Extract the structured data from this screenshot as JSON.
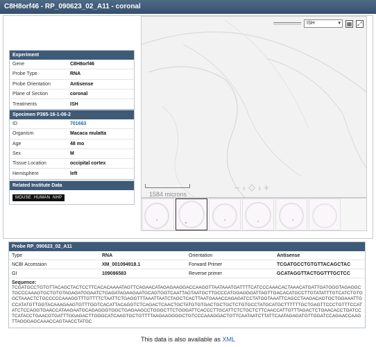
{
  "title": "C8H8orf46 - RP_090623_02_A11 - coronal",
  "experiment": {
    "header": "Experiment",
    "rows": [
      {
        "key": "Gene",
        "value": "C8H8orf46"
      },
      {
        "key": "Probe Type",
        "value": "RNA"
      },
      {
        "key": "Probe Orientation",
        "value": "Antisense"
      },
      {
        "key": "Plane of Section",
        "value": "coronal"
      },
      {
        "key": "Treatments",
        "value": "ISH"
      }
    ]
  },
  "specimen": {
    "header": "Specimen P365-16-1-06-2",
    "rows": [
      {
        "key": "ID",
        "value": "701663"
      },
      {
        "key": "Organism",
        "value": "Macaca mulatta"
      },
      {
        "key": "Age",
        "value": "48 mo"
      },
      {
        "key": "Sex",
        "value": "M"
      },
      {
        "key": "Tissue Location",
        "value": "occipital cortex"
      },
      {
        "key": "Hemisphere",
        "value": "left"
      }
    ]
  },
  "related": {
    "header": "Related Institute Data",
    "items": [
      "MOUSE",
      "HUMAN",
      "NHP"
    ]
  },
  "viewer": {
    "stain_select": "ISH",
    "scale_label": "1584 microns",
    "selected_thumbnail": 2,
    "thumbnail_count": 6
  },
  "probe": {
    "header": "Probe RP_090623_02_A11",
    "rows": [
      {
        "k1": "Type",
        "v1": "RNA",
        "k2": "Orientation",
        "v2": "Antisense"
      },
      {
        "k1": "NCBI Accession",
        "v1": "XM_001094918.1",
        "k2": "Forward Primer",
        "v2": "TCGATGCCTGTGTTACAGCTAC"
      },
      {
        "k1": "GI",
        "v1": "109086583",
        "k2": "Reverse primer",
        "v2": "GCATAGGTTACTGGTTTGCTCC"
      }
    ],
    "sequence_label": "Sequence:",
    "sequence": "TCGATGCCTGTGTTACAGCTACTCCTTCACACAAAATAGTTCAGAACATAGAGAAGGACCAAGGTTAATAAATGATTTTCATCCCAAACACTAAACATGATTGATGGGTAGAGGCTGCCCAAAGTGCTGTGTAGAGATGGAATCTGAGATAGAAGAATGCAGTGGTCAATTAGTAATGCTTGCCCATGGAGGGATTAGTTGACACATGCCTTGTATATTTGTCATCTGTGGCTAAACTCTGCCCCCAAAGGTTTGTTTTCTAATTCTGAGGTTTAAATTAATCTAGCTCACTTAATGAAACCAGAGATCCTATGGTAAATTCAGCCTAAGACAGTGCTGGAAATTGCCATATGTTGGTACAAAGAAGTGTTTGGTCACATTACAGGTCTCAGACTCAACTGCTATGTGTGACTGCTGCTCTGTGCCTATGCATGCTTTTTTGCTGAGTTCCCTGTTTCCATATCTCCAGGTGAACCATAAGAATGCAGAGGGTGGCTGAGAAGCCTGGGCTTCTGGGATTCACCCTTGCATTCTCTGCTCTTCAACCATTGTTTAGACTCTGAACACCTGATCCTCATACCTGAACGTGATTTGGAGACTTGGGCATCAAGTGCTGTTTTAAGAAGGGGCTGTCCCAAAGGACTGTTCAATAATCTTATTCAATAGAGATGTTGGATCCAGAACCAAGTTAGGGAGCAAACCAGTAACCTATGC"
  },
  "footer": {
    "text": "This data is also available as",
    "link": "XML"
  }
}
